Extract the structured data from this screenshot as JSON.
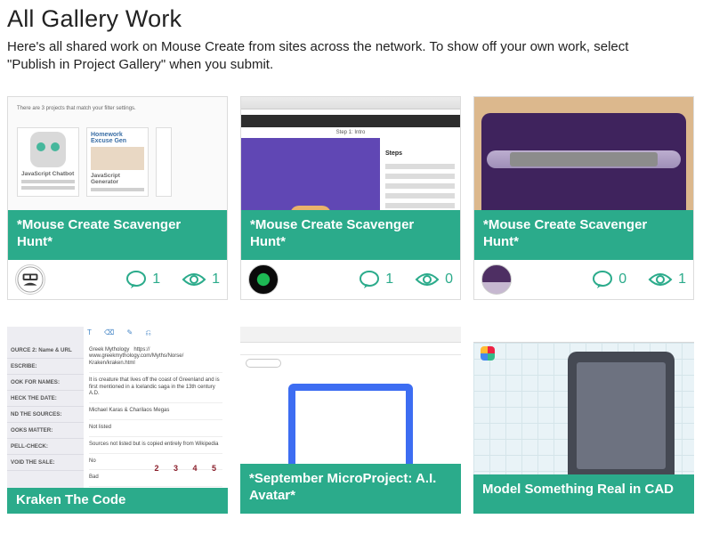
{
  "header": {
    "title": "All Gallery Work",
    "description": "Here's all shared work on Mouse Create from sites across the network. To show off your own work, select \"Publish in Project Gallery\" when you submit."
  },
  "accent_color": "#2bab8b",
  "cards": [
    {
      "title": "*Mouse Create Scavenger Hunt*",
      "comments": 1,
      "views": 1,
      "has_stats": true,
      "avatar": "av1"
    },
    {
      "title": "*Mouse Create Scavenger Hunt*",
      "comments": 1,
      "views": 0,
      "has_stats": true,
      "avatar": "av2"
    },
    {
      "title": "*Mouse Create Scavenger Hunt*",
      "comments": 0,
      "views": 1,
      "has_stats": true,
      "avatar": "av3"
    },
    {
      "title": "Kraken The Code",
      "has_stats": false
    },
    {
      "title": "*September MicroProject: A.I. Avatar*",
      "has_stats": false
    },
    {
      "title": "Model Something Real in CAD",
      "has_stats": false
    }
  ]
}
